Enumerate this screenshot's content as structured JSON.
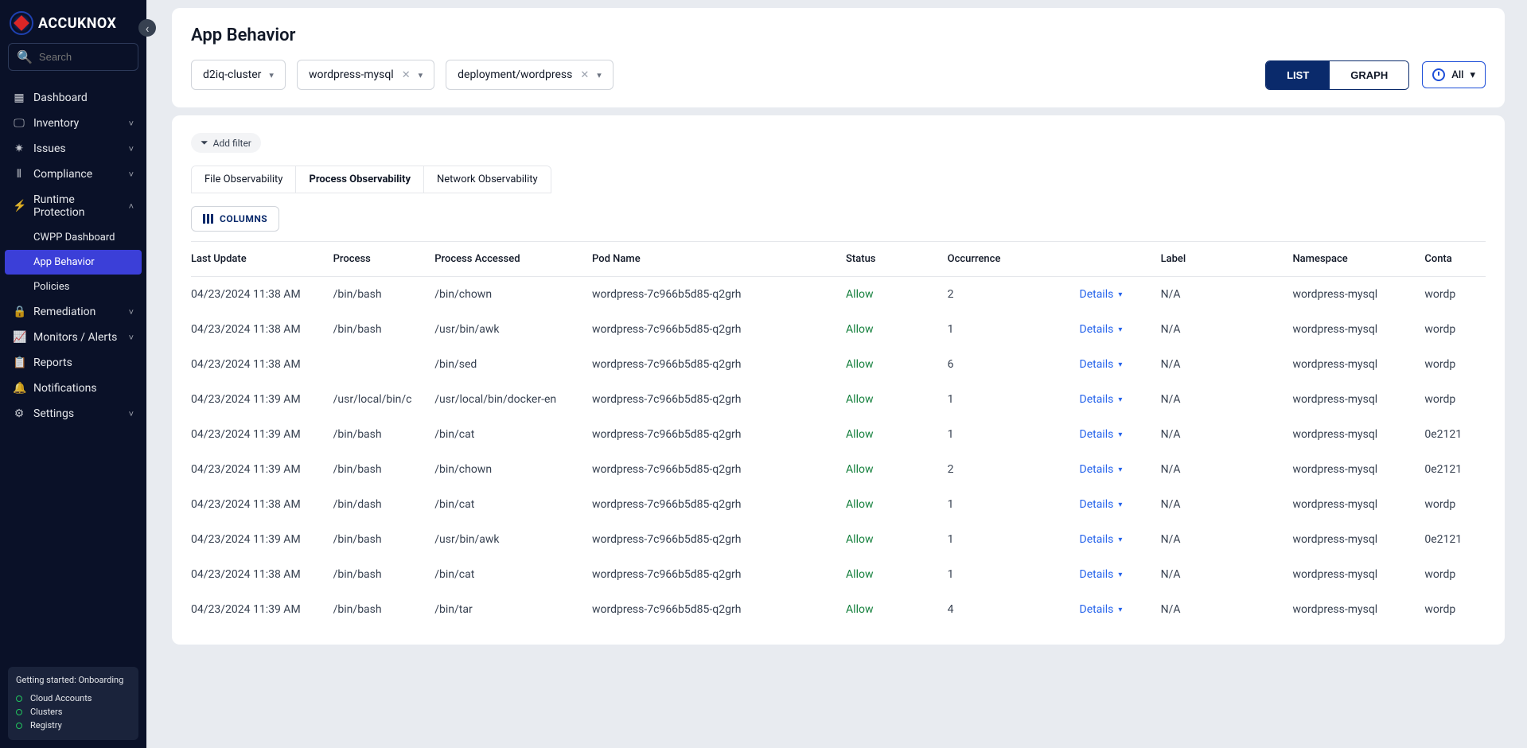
{
  "brand": "ACCUKNOX",
  "search": {
    "placeholder": "Search"
  },
  "sidebar": {
    "items": [
      {
        "label": "Dashboard",
        "icon": "▦",
        "expandable": false
      },
      {
        "label": "Inventory",
        "icon": "🖵",
        "expandable": true
      },
      {
        "label": "Issues",
        "icon": "✷",
        "expandable": true
      },
      {
        "label": "Compliance",
        "icon": "⫴",
        "expandable": true
      },
      {
        "label": "Runtime Protection",
        "icon": "⚡",
        "expandable": true,
        "expanded": true,
        "children": [
          {
            "label": "CWPP Dashboard"
          },
          {
            "label": "App Behavior",
            "active": true
          },
          {
            "label": "Policies"
          }
        ]
      },
      {
        "label": "Remediation",
        "icon": "🔒",
        "expandable": true
      },
      {
        "label": "Monitors / Alerts",
        "icon": "📈",
        "expandable": true
      },
      {
        "label": "Reports",
        "icon": "📋",
        "expandable": false
      },
      {
        "label": "Notifications",
        "icon": "🔔",
        "expandable": false
      },
      {
        "label": "Settings",
        "icon": "⚙",
        "expandable": true
      }
    ]
  },
  "onboarding": {
    "title": "Getting started: Onboarding",
    "steps": [
      "Cloud Accounts",
      "Clusters",
      "Registry"
    ]
  },
  "page": {
    "title": "App Behavior",
    "filters": {
      "cluster": "d2iq-cluster",
      "namespace": "wordpress-mysql",
      "workload": "deployment/wordpress"
    },
    "view_toggle": {
      "list": "LIST",
      "graph": "GRAPH",
      "active": "list"
    },
    "time": "All",
    "add_filter": "Add filter",
    "tabs": [
      "File Observability",
      "Process Observability",
      "Network Observability"
    ],
    "active_tab": 1,
    "columns_btn": "COLUMNS",
    "details_label": "Details",
    "headers": [
      "Last Update",
      "Process",
      "Process Accessed",
      "Pod Name",
      "Status",
      "Occurrence",
      "",
      "Label",
      "Namespace",
      "Conta"
    ],
    "rows": [
      {
        "update": "04/23/2024 11:38 AM",
        "process": "/bin/bash",
        "accessed": "/bin/chown",
        "pod": "wordpress-7c966b5d85-q2grh",
        "status": "Allow",
        "occur": "2",
        "label": "N/A",
        "ns": "wordpress-mysql",
        "cont": "wordp"
      },
      {
        "update": "04/23/2024 11:38 AM",
        "process": "/bin/bash",
        "accessed": "/usr/bin/awk",
        "pod": "wordpress-7c966b5d85-q2grh",
        "status": "Allow",
        "occur": "1",
        "label": "N/A",
        "ns": "wordpress-mysql",
        "cont": "wordp"
      },
      {
        "update": "04/23/2024 11:38 AM",
        "process": "",
        "accessed": "/bin/sed",
        "pod": "wordpress-7c966b5d85-q2grh",
        "status": "Allow",
        "occur": "6",
        "label": "N/A",
        "ns": "wordpress-mysql",
        "cont": "wordp"
      },
      {
        "update": "04/23/2024 11:39 AM",
        "process": "/usr/local/bin/c",
        "accessed": "/usr/local/bin/docker-en",
        "pod": "wordpress-7c966b5d85-q2grh",
        "status": "Allow",
        "occur": "1",
        "label": "N/A",
        "ns": "wordpress-mysql",
        "cont": "wordp"
      },
      {
        "update": "04/23/2024 11:39 AM",
        "process": "/bin/bash",
        "accessed": "/bin/cat",
        "pod": "wordpress-7c966b5d85-q2grh",
        "status": "Allow",
        "occur": "1",
        "label": "N/A",
        "ns": "wordpress-mysql",
        "cont": "0e2121"
      },
      {
        "update": "04/23/2024 11:39 AM",
        "process": "/bin/bash",
        "accessed": "/bin/chown",
        "pod": "wordpress-7c966b5d85-q2grh",
        "status": "Allow",
        "occur": "2",
        "label": "N/A",
        "ns": "wordpress-mysql",
        "cont": "0e2121"
      },
      {
        "update": "04/23/2024 11:38 AM",
        "process": "/bin/dash",
        "accessed": "/bin/cat",
        "pod": "wordpress-7c966b5d85-q2grh",
        "status": "Allow",
        "occur": "1",
        "label": "N/A",
        "ns": "wordpress-mysql",
        "cont": "wordp"
      },
      {
        "update": "04/23/2024 11:39 AM",
        "process": "/bin/bash",
        "accessed": "/usr/bin/awk",
        "pod": "wordpress-7c966b5d85-q2grh",
        "status": "Allow",
        "occur": "1",
        "label": "N/A",
        "ns": "wordpress-mysql",
        "cont": "0e2121"
      },
      {
        "update": "04/23/2024 11:38 AM",
        "process": "/bin/bash",
        "accessed": "/bin/cat",
        "pod": "wordpress-7c966b5d85-q2grh",
        "status": "Allow",
        "occur": "1",
        "label": "N/A",
        "ns": "wordpress-mysql",
        "cont": "wordp"
      },
      {
        "update": "04/23/2024 11:39 AM",
        "process": "/bin/bash",
        "accessed": "/bin/tar",
        "pod": "wordpress-7c966b5d85-q2grh",
        "status": "Allow",
        "occur": "4",
        "label": "N/A",
        "ns": "wordpress-mysql",
        "cont": "wordp"
      }
    ]
  }
}
